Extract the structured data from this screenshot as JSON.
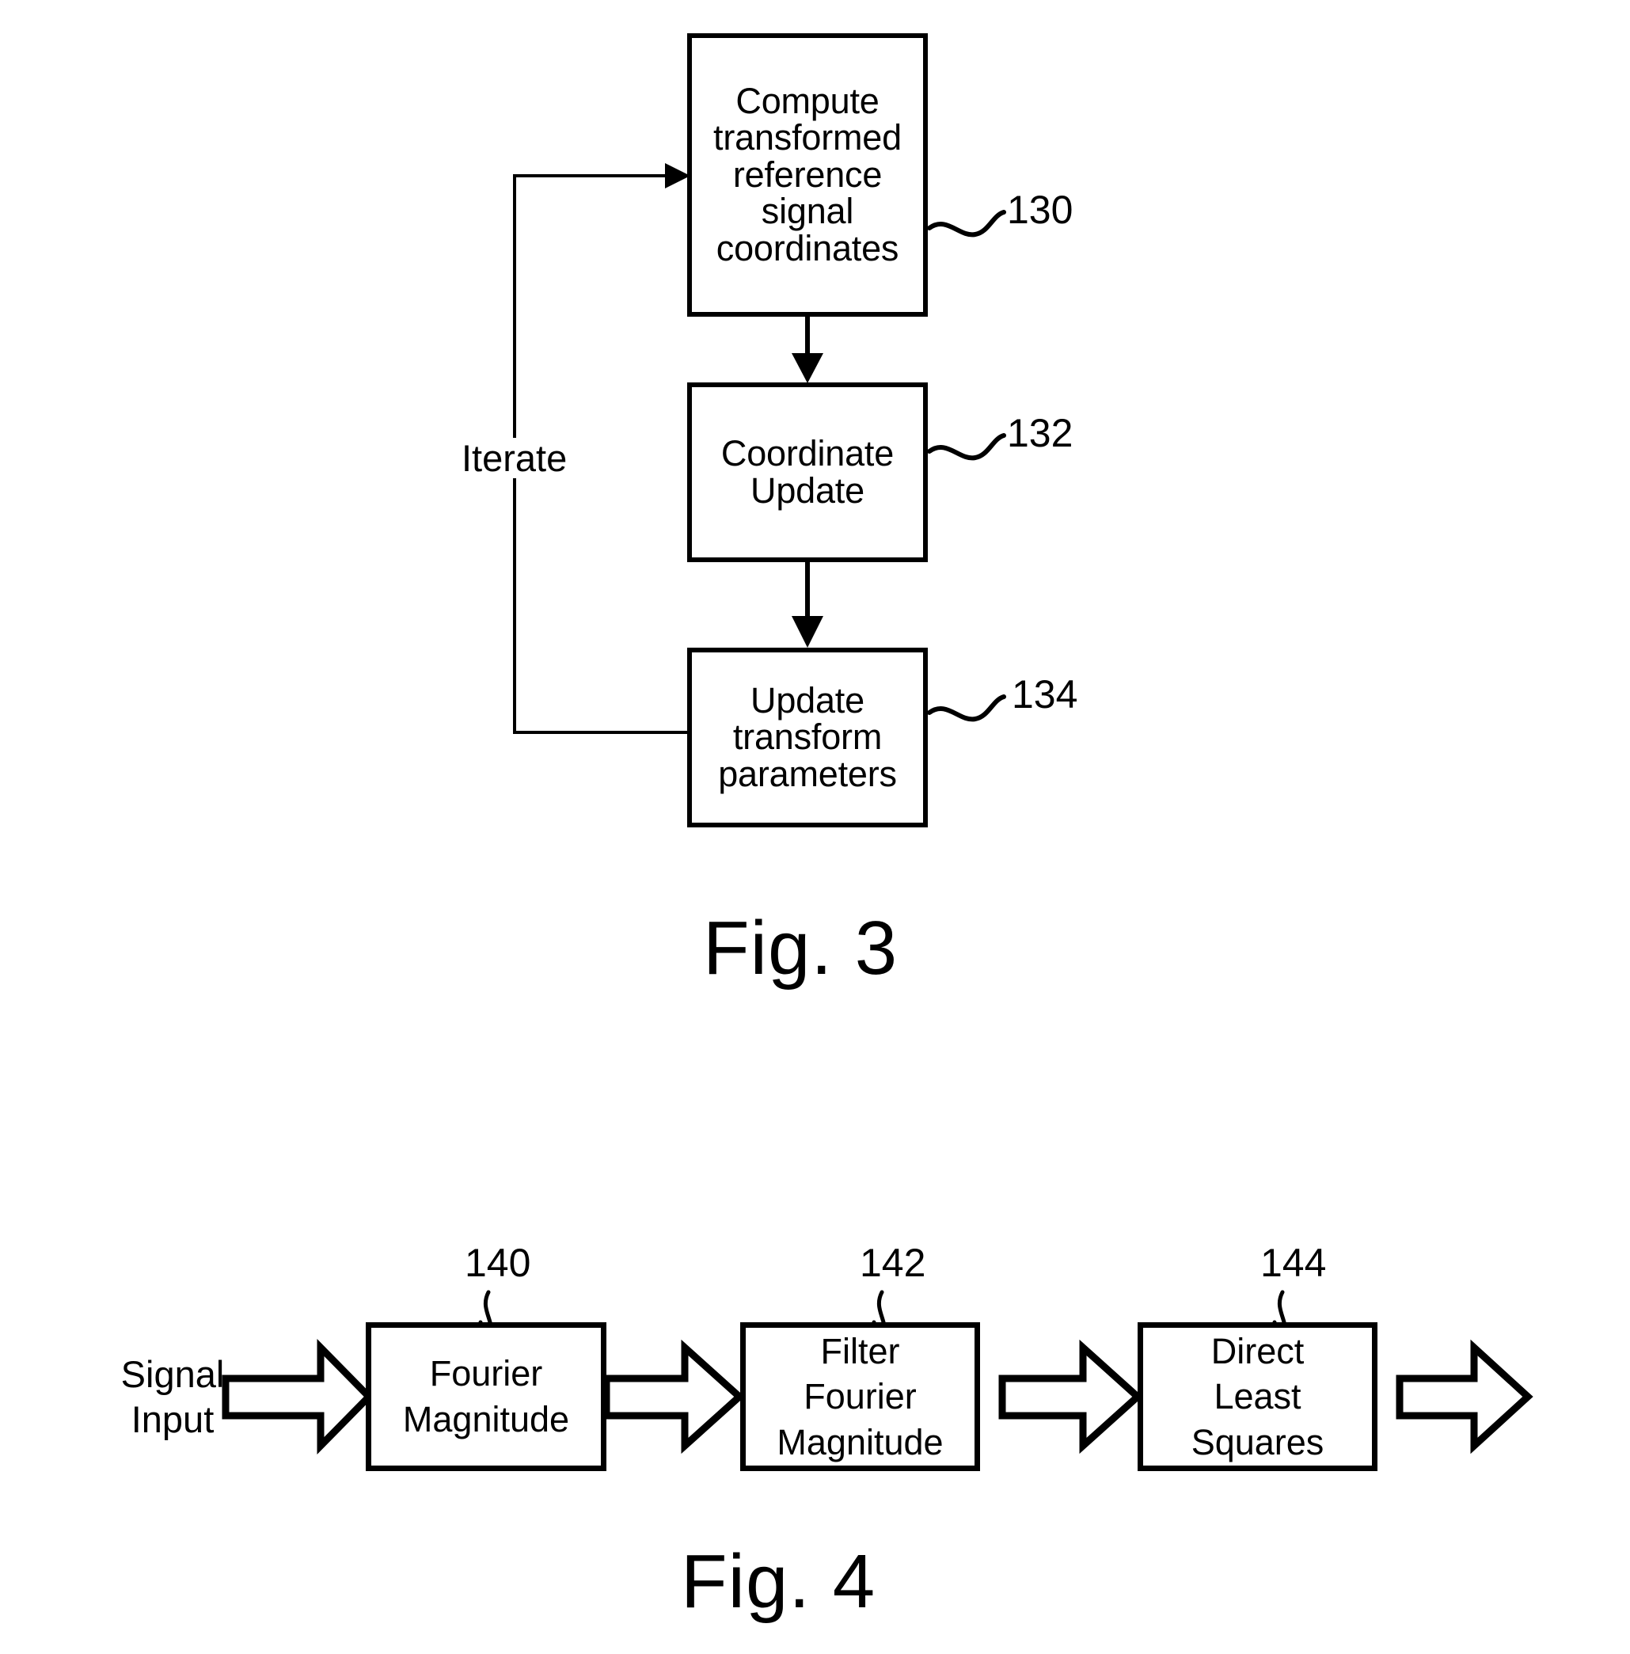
{
  "document": {
    "kind": "patent-drawing-sheet",
    "figures": [
      "Fig. 3",
      "Fig. 4"
    ]
  },
  "fig3": {
    "caption": "Fig. 3",
    "iterate_label": "Iterate",
    "blocks": [
      {
        "id": "compute-transformed-reference-signal-coordinates",
        "text": "Compute\ntransformed\nreference\nsignal\ncoordinates",
        "ref": "130"
      },
      {
        "id": "coordinate-update",
        "text": "Coordinate\nUpdate",
        "ref": "132"
      },
      {
        "id": "update-transform-parameters",
        "text": "Update\ntransform\nparameters",
        "ref": "134"
      }
    ]
  },
  "fig4": {
    "caption": "Fig. 4",
    "input_label": "Signal\nInput",
    "blocks": [
      {
        "id": "fourier-magnitude",
        "text": "Fourier\nMagnitude",
        "ref": "140"
      },
      {
        "id": "filter-fourier-magnitude",
        "text": "Filter\nFourier\nMagnitude",
        "ref": "142"
      },
      {
        "id": "direct-least-squares",
        "text": "Direct\nLeast\nSquares",
        "ref": "144"
      }
    ]
  },
  "style": {
    "ink": "#000000",
    "paper": "#ffffff"
  }
}
